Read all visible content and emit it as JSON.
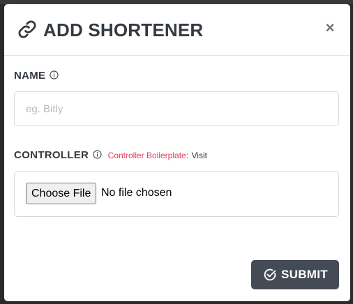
{
  "modal": {
    "title": "ADD SHORTENER",
    "title_icon": "link-icon",
    "close_label": "×"
  },
  "name_field": {
    "label": "NAME",
    "info_icon": "info-icon",
    "placeholder": "eg. Bitly",
    "value": ""
  },
  "controller_field": {
    "label": "CONTROLLER",
    "info_icon": "info-icon",
    "boilerplate_text": "Controller Boilerplate:",
    "boilerplate_link": "Visit",
    "choose_button": "Choose File",
    "file_status": "No file chosen"
  },
  "submit": {
    "label": "SUBMIT",
    "icon": "check-circle-icon"
  },
  "colors": {
    "title": "#343a40",
    "accent_link": "#e6375f",
    "submit_bg": "#454b54"
  }
}
